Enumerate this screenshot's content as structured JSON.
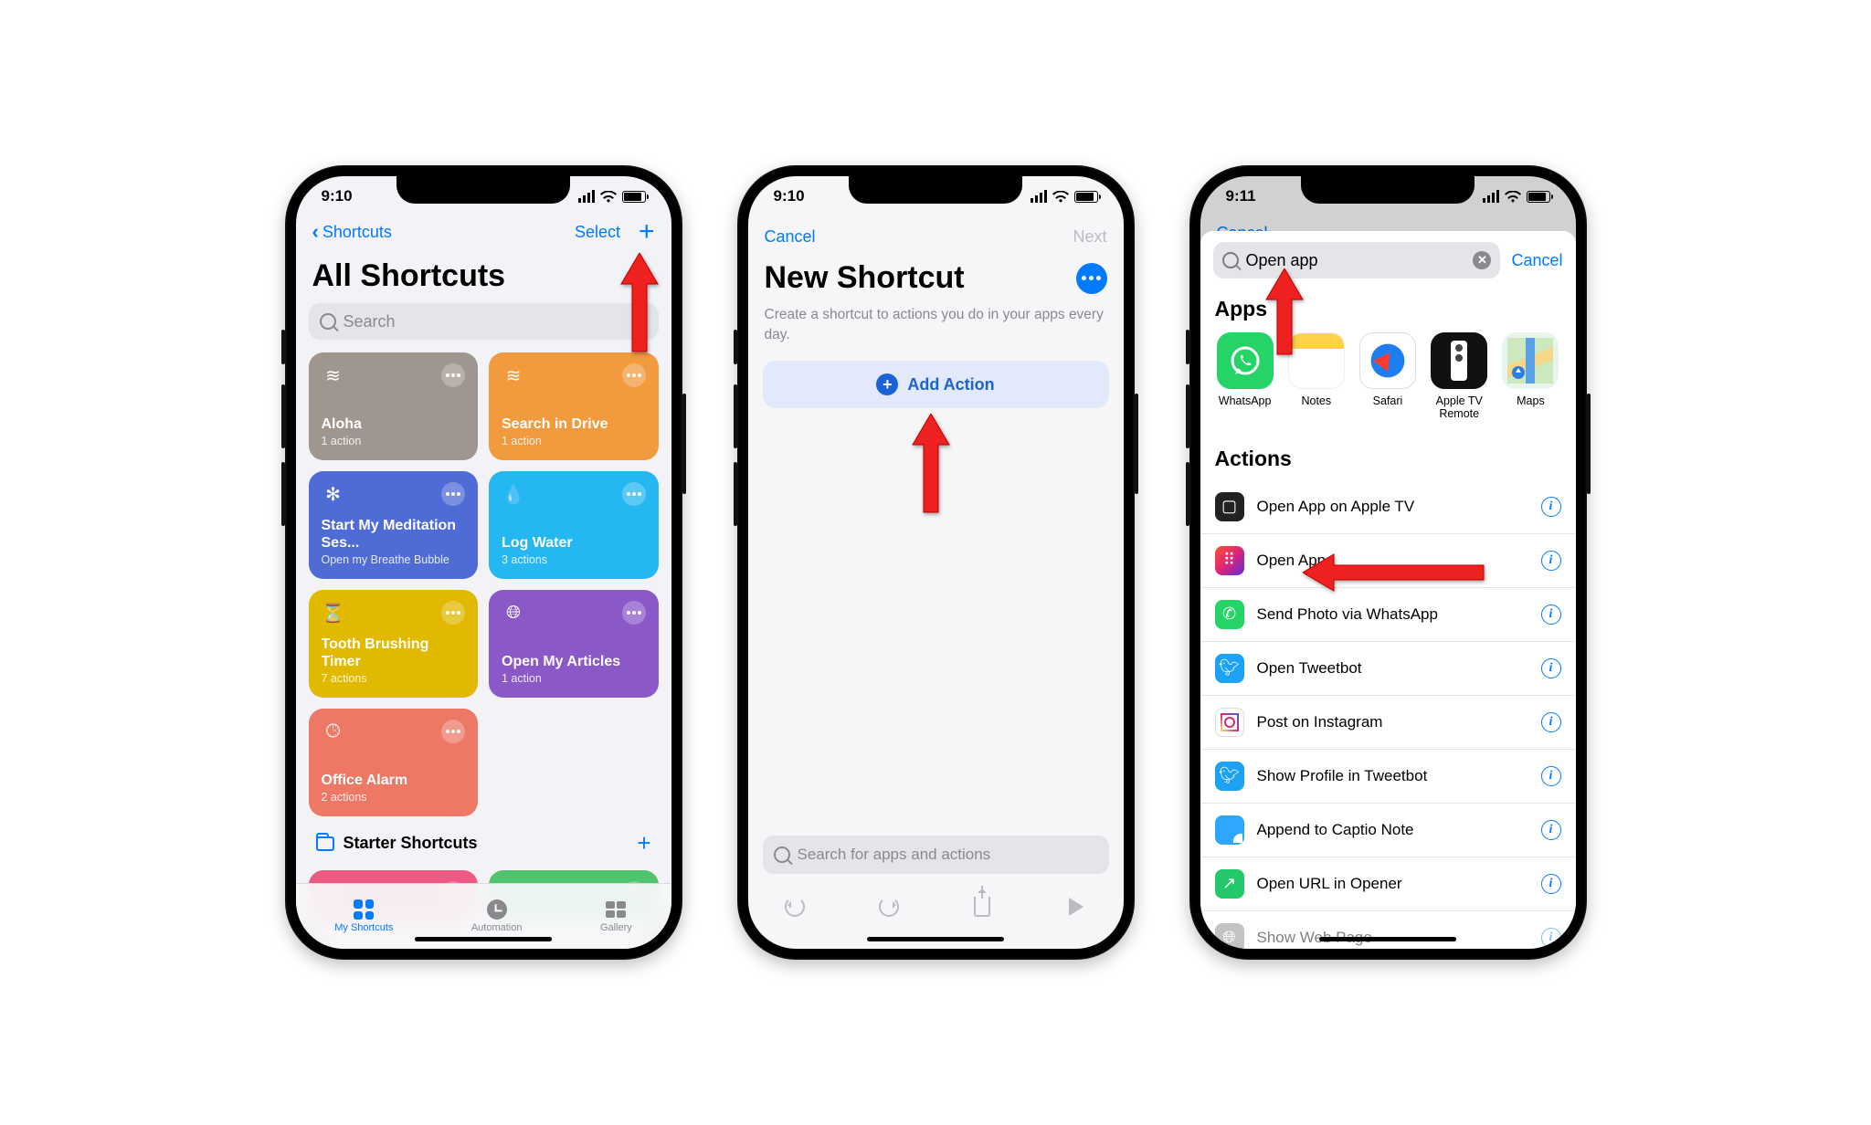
{
  "phone1": {
    "time": "9:10",
    "back_label": "Shortcuts",
    "select_label": "Select",
    "title": "All Shortcuts",
    "search_placeholder": "Search",
    "tiles": [
      {
        "title": "Aloha",
        "sub": "1 action",
        "icon": "stack"
      },
      {
        "title": "Search in Drive",
        "sub": "1 action",
        "icon": "stack"
      },
      {
        "title": "Start My Meditation Ses...",
        "sub": "Open my Breathe Bubble",
        "icon": "sparkle"
      },
      {
        "title": "Log Water",
        "sub": "3 actions",
        "icon": "drop"
      },
      {
        "title": "Tooth Brushing Timer",
        "sub": "7 actions",
        "icon": "hourglass"
      },
      {
        "title": "Open My Articles",
        "sub": "1 action",
        "icon": "globe"
      },
      {
        "title": "Office Alarm",
        "sub": "2 actions",
        "icon": "clock"
      }
    ],
    "folder_label": "Starter Shortcuts",
    "tabs": {
      "shortcuts": "My Shortcuts",
      "automation": "Automation",
      "gallery": "Gallery"
    }
  },
  "phone2": {
    "time": "9:10",
    "cancel": "Cancel",
    "next": "Next",
    "title": "New Shortcut",
    "desc": "Create a shortcut to actions you do in your apps every day.",
    "add_action": "Add Action",
    "search_placeholder": "Search for apps and actions"
  },
  "phone3": {
    "time": "9:11",
    "behind_cancel": "Cancel",
    "search_value": "Open app",
    "cancel": "Cancel",
    "apps_header": "Apps",
    "apps": [
      "WhatsApp",
      "Notes",
      "Safari",
      "Apple TV Remote",
      "Maps"
    ],
    "actions_header": "Actions",
    "actions": [
      "Open App on Apple TV",
      "Open App",
      "Send Photo via WhatsApp",
      "Open Tweetbot",
      "Post on Instagram",
      "Show Profile in Tweetbot",
      "Append to Captio Note",
      "Open URL in Opener",
      "Show Web Page"
    ]
  }
}
